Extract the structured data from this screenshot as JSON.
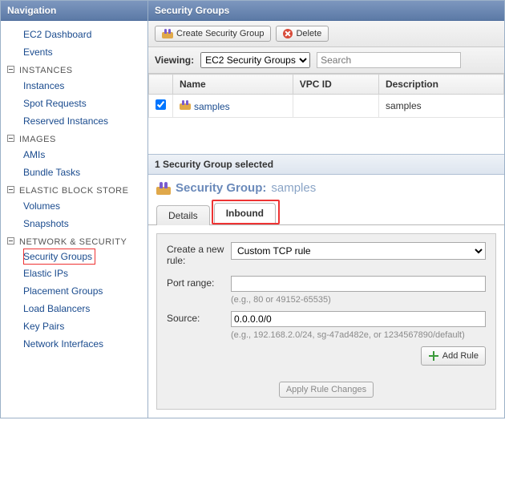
{
  "sidebar": {
    "title": "Navigation",
    "top_items": [
      {
        "label": "EC2 Dashboard"
      },
      {
        "label": "Events"
      }
    ],
    "groups": [
      {
        "title": "INSTANCES",
        "items": [
          "Instances",
          "Spot Requests",
          "Reserved Instances"
        ]
      },
      {
        "title": "IMAGES",
        "items": [
          "AMIs",
          "Bundle Tasks"
        ]
      },
      {
        "title": "ELASTIC BLOCK STORE",
        "items": [
          "Volumes",
          "Snapshots"
        ]
      },
      {
        "title": "NETWORK & SECURITY",
        "items": [
          "Security Groups",
          "Elastic IPs",
          "Placement Groups",
          "Load Balancers",
          "Key Pairs",
          "Network Interfaces"
        ],
        "highlight": "Security Groups"
      }
    ]
  },
  "main": {
    "title": "Security Groups",
    "buttons": {
      "create": "Create Security Group",
      "delete": "Delete"
    },
    "viewing_label": "Viewing:",
    "viewing_value": "EC2 Security Groups",
    "search_placeholder": "Search",
    "table": {
      "headers": [
        "Name",
        "VPC ID",
        "Description"
      ],
      "rows": [
        {
          "checked": true,
          "name": "samples",
          "vpc": "",
          "desc": "samples"
        }
      ]
    },
    "detail": {
      "selected_text": "1 Security Group selected",
      "title_label": "Security Group:",
      "title_name": "samples",
      "tabs": [
        "Details",
        "Inbound"
      ],
      "active_tab": "Inbound",
      "form": {
        "create_rule_label": "Create a new rule:",
        "rule_value": "Custom TCP rule",
        "port_label": "Port range:",
        "port_value": "",
        "port_hint": "(e.g., 80 or 49152-65535)",
        "source_label": "Source:",
        "source_value": "0.0.0.0/0",
        "source_hint": "(e.g., 192.168.2.0/24, sg-47ad482e, or 1234567890/default)",
        "add_rule": "Add Rule",
        "apply": "Apply Rule Changes"
      }
    }
  }
}
